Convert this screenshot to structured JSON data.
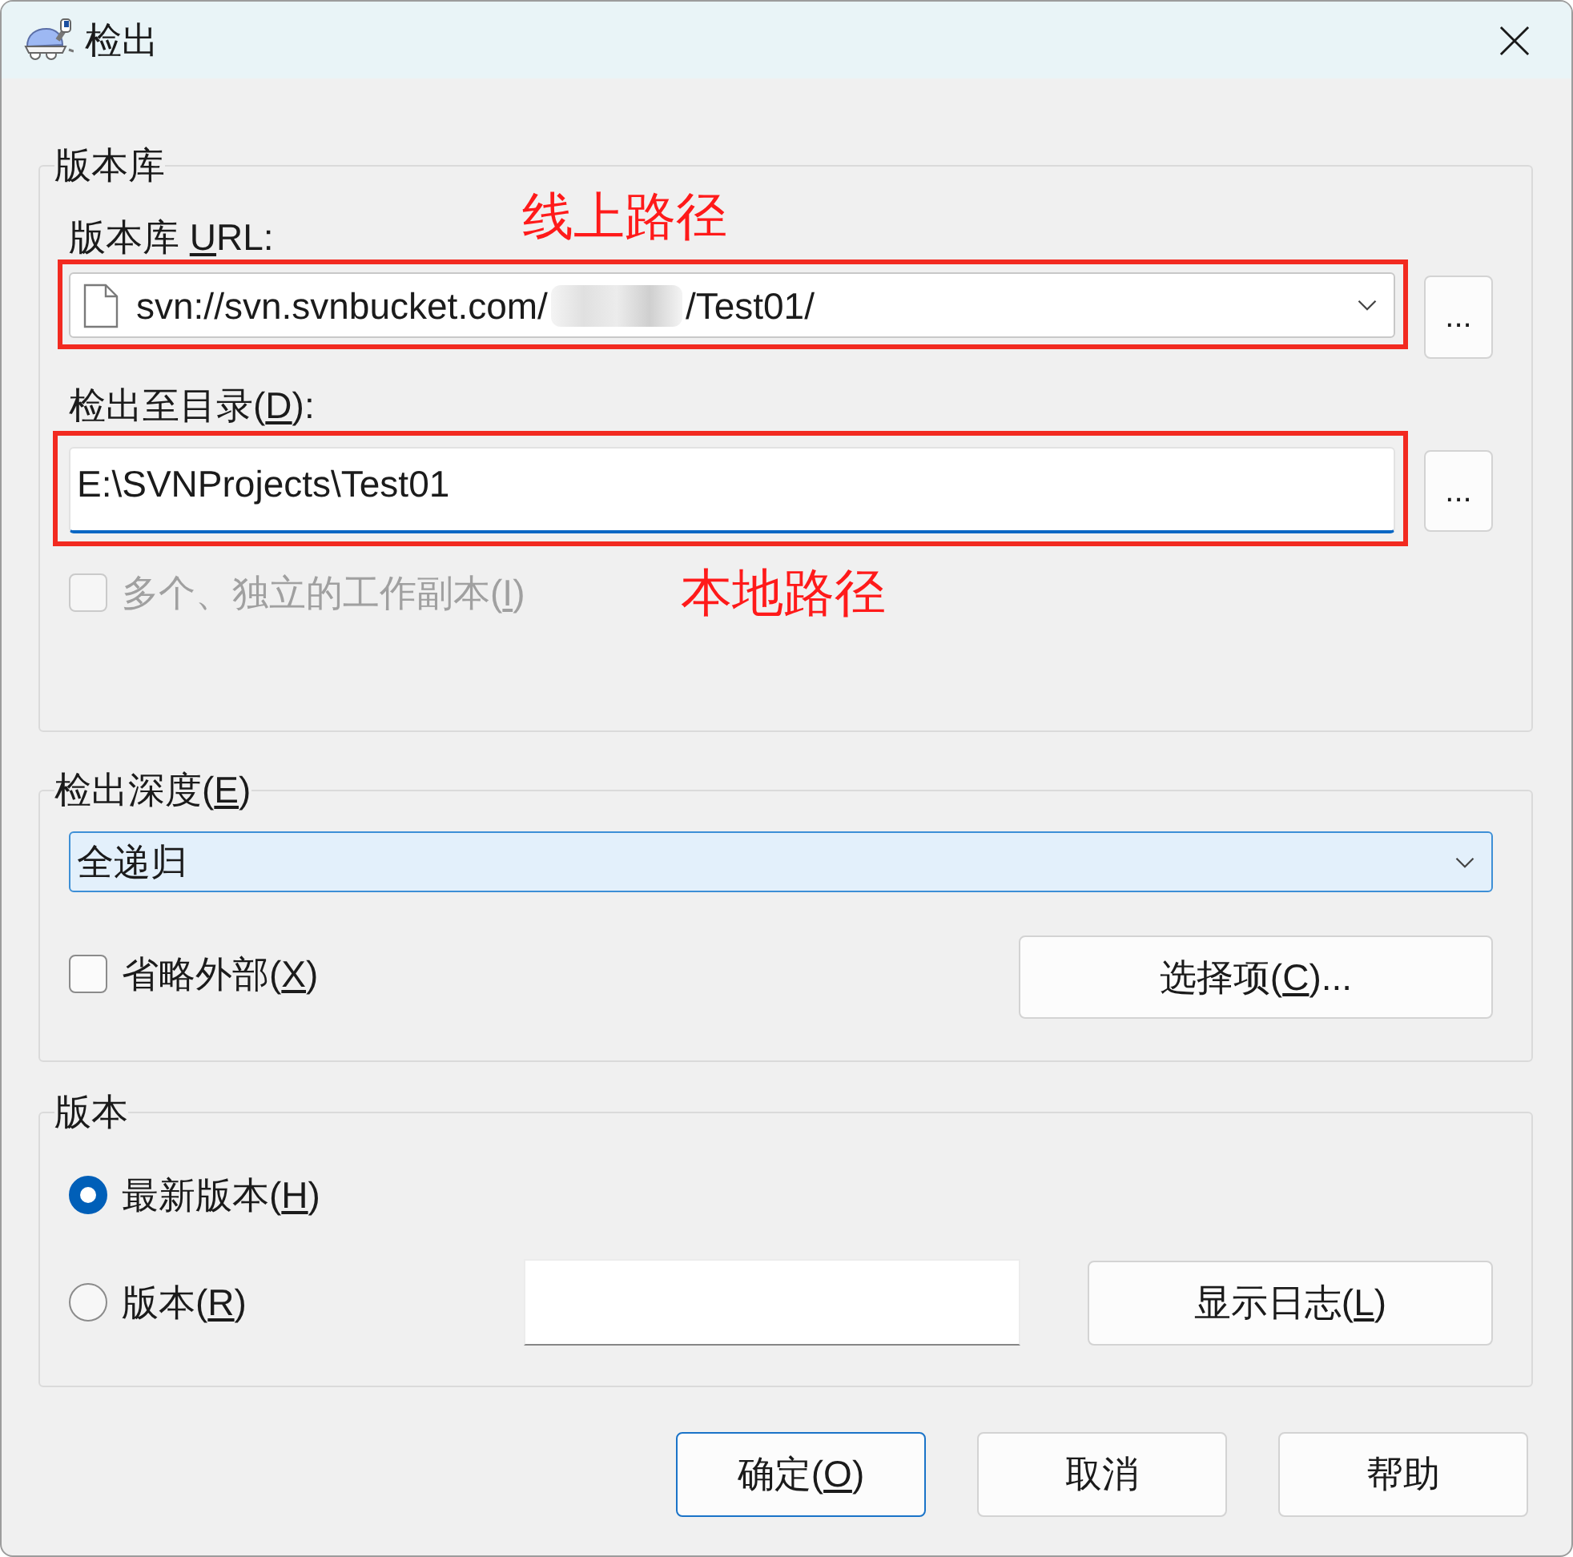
{
  "window": {
    "title": "检出"
  },
  "repository": {
    "legend": "版本库",
    "url_label": {
      "pre": "版本库 ",
      "key": "U",
      "post": "RL:"
    },
    "url": {
      "prefix": "svn://svn.svnbucket.com/",
      "redacted": true,
      "suffix": "/Test01/",
      "annotation": "线上路径"
    },
    "url_browse": "...",
    "dir_label": {
      "pre": "检出至目录(",
      "key": "D",
      "post": "):"
    },
    "dir": {
      "value": "E:\\SVNProjects\\Test01",
      "focused": true,
      "annotation": "本地路径"
    },
    "dir_browse": "...",
    "independent": {
      "label": {
        "pre": "多个、独立的工作副本(",
        "key": "I",
        "post": ")"
      },
      "checked": false,
      "disabled": true
    }
  },
  "depth": {
    "legend": {
      "pre": "检出深度(",
      "key": "E",
      "post": ")"
    },
    "value": "全递归",
    "hovered": true,
    "omit_externals": {
      "label": {
        "pre": "省略外部(",
        "key": "X",
        "post": ")"
      },
      "checked": false,
      "disabled": false
    },
    "items_button": {
      "pre": "选择项(",
      "key": "C",
      "post": ")..."
    }
  },
  "revision": {
    "legend": "版本",
    "options": [
      {
        "label": {
          "pre": "最新版本(",
          "key": "H",
          "post": ")"
        },
        "selected": true
      },
      {
        "label": {
          "pre": "版本(",
          "key": "R",
          "post": ")"
        },
        "selected": false
      }
    ],
    "show_log": {
      "pre": "显示日志(",
      "key": "L",
      "post": ")"
    }
  },
  "buttons": [
    {
      "label": {
        "pre": "确定(",
        "key": "O",
        "post": ")"
      },
      "default": true
    },
    {
      "label": "取消",
      "default": false
    },
    {
      "label": "帮助",
      "default": false
    }
  ]
}
